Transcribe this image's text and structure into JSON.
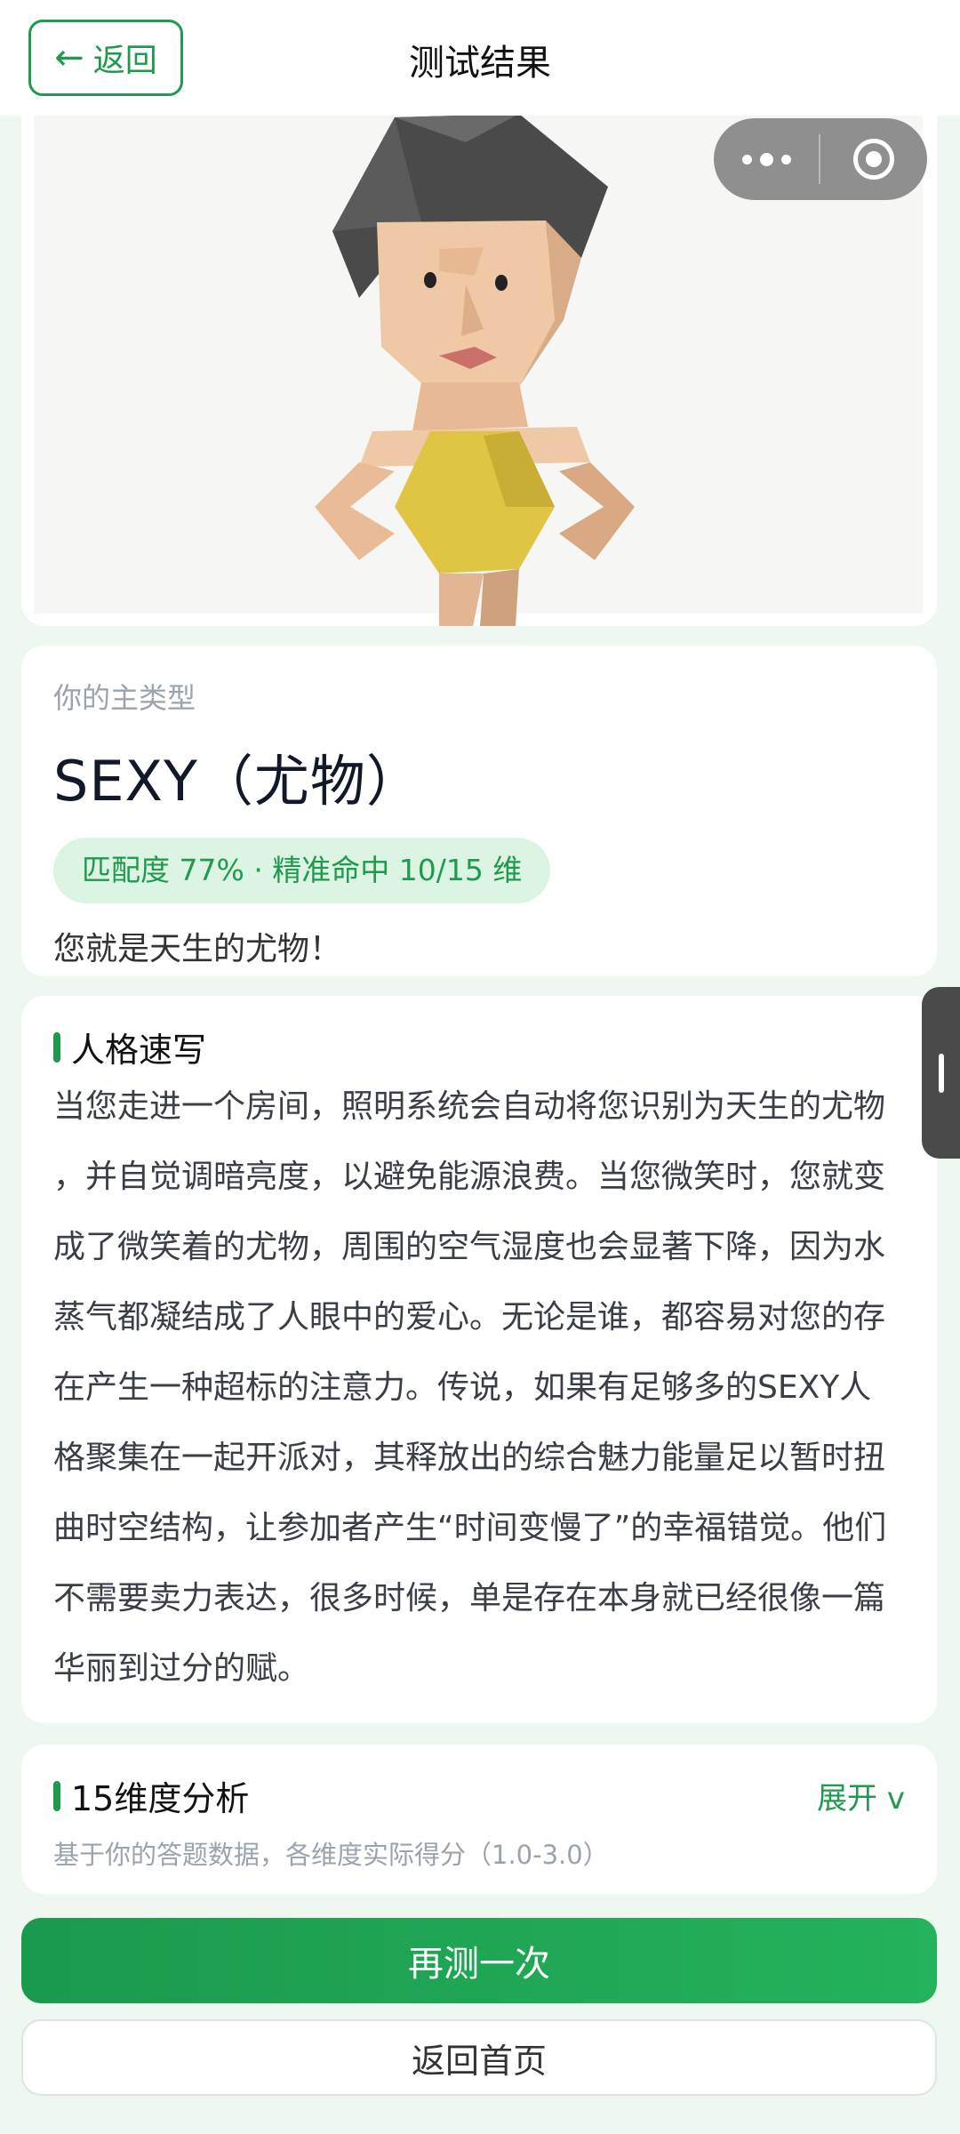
{
  "nav": {
    "back_label": "返回",
    "title": "测试结果"
  },
  "result": {
    "type_label": "你的主类型",
    "type_name": "SEXY（尤物）",
    "match": "匹配度 77% · 精准命中 10/15 维",
    "desc": "您就是天生的尤物！"
  },
  "sketch": {
    "title": "人格速写",
    "lines": [
      "当您走进一个房间，照明系统会自动将您识别为天生的尤物",
      "，并自觉调暗亮度，以避免能源浪费。当您微笑时，您就变",
      "成了微笑着的尤物，周围的空气湿度也会显著下降，因为水",
      "蒸气都凝结成了人眼中的爱心。无论是谁，都容易对您的存",
      "在产生一种超标的注意力。传说，如果有足够多的SEXY人",
      "格聚集在一起开派对，其释放出的综合魅力能量足以暂时扭",
      "曲时空结构，让参加者产生“时间变慢了”的幸福错觉。他们",
      "不需要卖力表达，很多时候，单是存在本身就已经很像一篇",
      "华丽到过分的赋。"
    ]
  },
  "dimensions": {
    "title": "15维度分析",
    "expand_label": "展开 v",
    "subtitle": "基于你的答题数据，各维度实际得分（1.0-3.0）"
  },
  "actions": {
    "retest_label": "再测一次",
    "home_label": "返回首页"
  },
  "colors": {
    "accent": "#1f9a4e",
    "pill_bg": "#dcf5e3",
    "page_bg": "#eef8f1"
  }
}
